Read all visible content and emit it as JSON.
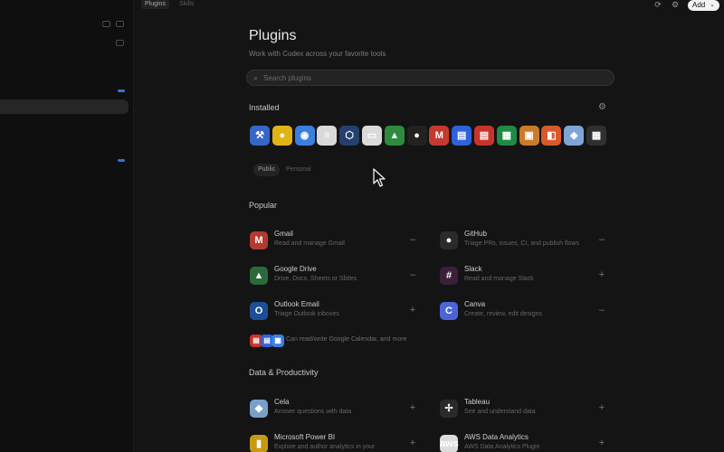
{
  "topbar": {
    "tab_active": "Plugins",
    "tab_other": "Skills",
    "add_label": "Add"
  },
  "main": {
    "title": "Plugins",
    "subtitle": "Work with Codex across your favorite tools",
    "search_placeholder": "Search plugins",
    "installed_title": "Installed",
    "filters": {
      "active": "Public",
      "other": "Personal"
    },
    "popular_title": "Popular",
    "popular": [
      {
        "name": "Gmail",
        "desc": "Read and manage Gmail",
        "icon": "gmail-icon",
        "glyph": "M",
        "color": "#b23a30",
        "action": "–"
      },
      {
        "name": "GitHub",
        "desc": "Triage PRs, issues, CI, and publish flows",
        "icon": "github-icon",
        "glyph": "●",
        "color": "#2b2b2b",
        "action": "–"
      },
      {
        "name": "Google Drive",
        "desc": "Drive, Docs, Sheets or Slides",
        "icon": "google-drive-icon",
        "glyph": "▲",
        "color": "#2a6a3a",
        "action": "–"
      },
      {
        "name": "Slack",
        "desc": "Read and manage Slack",
        "icon": "slack-icon",
        "glyph": "#",
        "color": "#3a2038",
        "action": "+"
      },
      {
        "name": "Outlook Email",
        "desc": "Triage Outlook inboxes",
        "icon": "outlook-icon",
        "glyph": "O",
        "color": "#1d4f96",
        "action": "+"
      },
      {
        "name": "Canva",
        "desc": "Create, review, edit designs",
        "icon": "canva-icon",
        "glyph": "C",
        "color": "#4d63d8",
        "action": "–"
      }
    ],
    "more_label": "Can read/write Google Calendar, and more",
    "data_title": "Data & Productivity",
    "data": [
      {
        "name": "Cela",
        "desc": "Answer questions with data",
        "icon": "cela-icon",
        "glyph": "◆",
        "color": "#7aa0c8",
        "action": "+"
      },
      {
        "name": "Tableau",
        "desc": "See and understand data",
        "icon": "tableau-icon",
        "glyph": "✢",
        "color": "#2a2a2a",
        "action": "+"
      },
      {
        "name": "Microsoft Power BI",
        "desc": "Explore and author analytics in your",
        "icon": "power-bi-icon",
        "glyph": "▮",
        "color": "#c59a12",
        "action": "+"
      },
      {
        "name": "AWS Data Analytics",
        "desc": "AWS Data Analytics Plugin",
        "icon": "aws-icon",
        "glyph": "aws",
        "color": "#dcdcdc",
        "action": "+"
      }
    ]
  },
  "installed": [
    {
      "icon": "xcode-icon",
      "glyph": "⚒",
      "color": "#3566c8"
    },
    {
      "icon": "notes-icon",
      "glyph": "●",
      "color": "#e2b317"
    },
    {
      "icon": "browser-icon",
      "glyph": "◉",
      "color": "#3a7fe0"
    },
    {
      "icon": "document-icon",
      "glyph": "≡",
      "color": "#d9d9d9"
    },
    {
      "icon": "cube-icon",
      "glyph": "⬡",
      "color": "#25406e"
    },
    {
      "icon": "window-icon",
      "glyph": "▭",
      "color": "#dadada"
    },
    {
      "icon": "google-drive-icon",
      "glyph": "▲",
      "color": "#2e8a3e"
    },
    {
      "icon": "github-icon",
      "glyph": "●",
      "color": "#222222"
    },
    {
      "icon": "gmail-icon",
      "glyph": "M",
      "color": "#c53a2e"
    },
    {
      "icon": "google-docs-icon",
      "glyph": "▤",
      "color": "#2f62d8"
    },
    {
      "icon": "pdf-icon",
      "glyph": "▤",
      "color": "#c8332b"
    },
    {
      "icon": "google-sheets-icon",
      "glyph": "▦",
      "color": "#1f8a45"
    },
    {
      "icon": "box-icon",
      "glyph": "▣",
      "color": "#c97b2a"
    },
    {
      "icon": "figma-icon",
      "glyph": "◧",
      "color": "#d85a2c"
    },
    {
      "icon": "maps-icon",
      "glyph": "◈",
      "color": "#7fa4d8"
    },
    {
      "icon": "grid-apps-icon",
      "glyph": "▦",
      "color": "#303030"
    }
  ]
}
